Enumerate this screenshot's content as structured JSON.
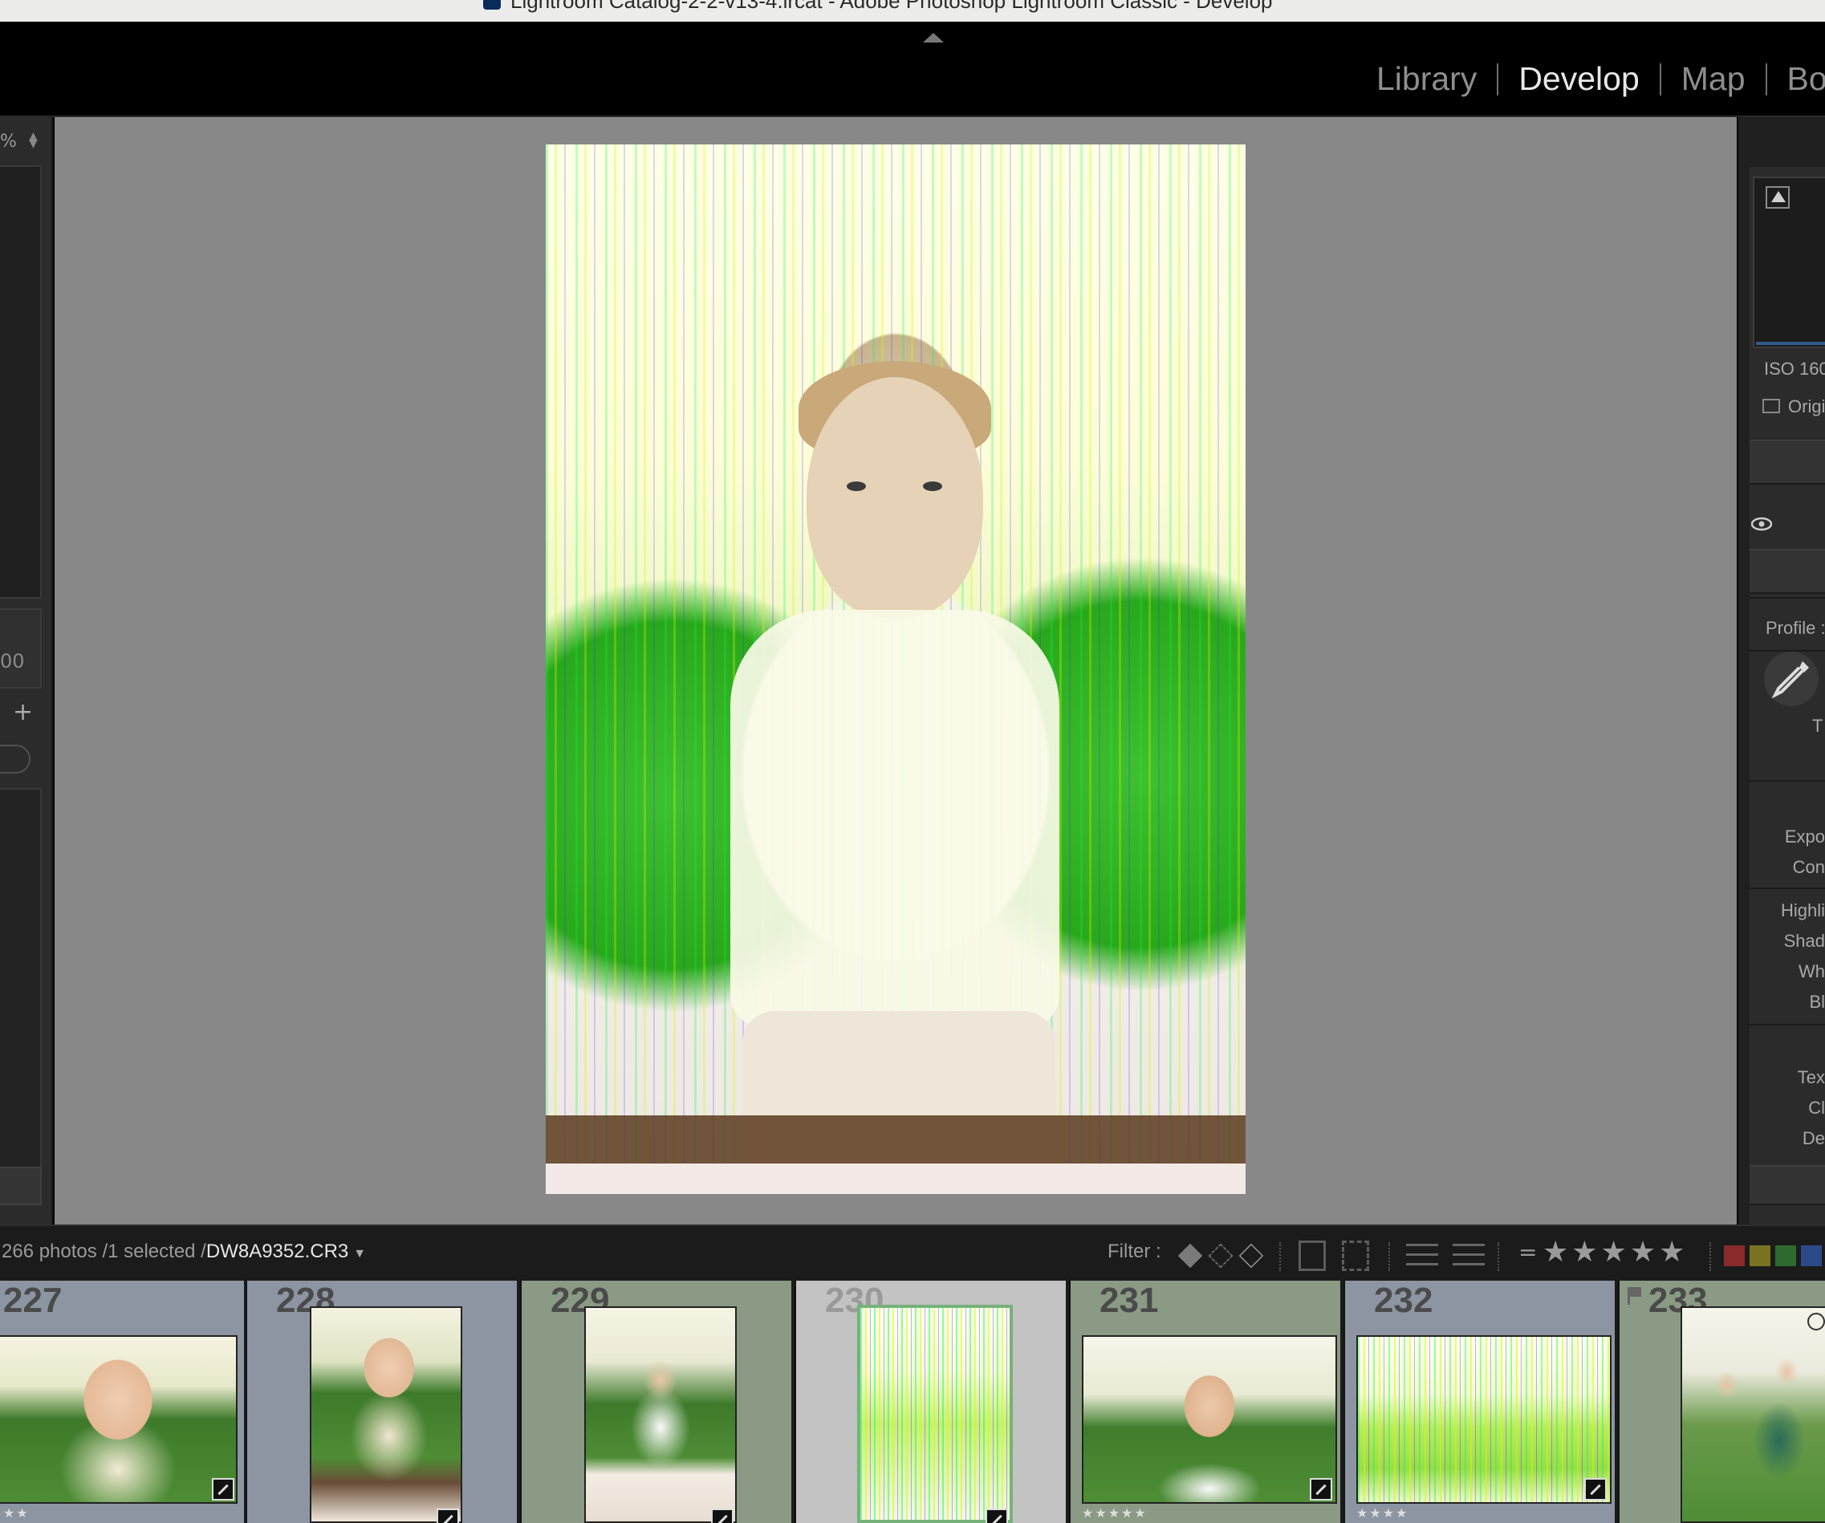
{
  "window": {
    "title": "Lightroom Catalog-2-2-v13-4.lrcat - Adobe Photoshop Lightroom Classic - Develop"
  },
  "modules": {
    "items": [
      {
        "label": "Library",
        "active": false
      },
      {
        "label": "Develop",
        "active": true
      },
      {
        "label": "Map",
        "active": false
      },
      {
        "label": "Boo",
        "active": false
      }
    ]
  },
  "left_panel": {
    "zoom_text": "%",
    "value_text": "00",
    "add_label": "+"
  },
  "right_panel": {
    "iso": "ISO 160",
    "original_label": "Origi",
    "profile_label": "Profile :",
    "wb_label": "T",
    "tone_labels": [
      "Expo",
      "Con"
    ],
    "presence_labels": [
      "Highli",
      "Shad",
      "Wh",
      "Bl"
    ],
    "texture_labels": [
      "Tex",
      "Cl",
      "De"
    ]
  },
  "filmstrip_bar": {
    "count_text": "266 photos /1 selected /",
    "filename": "DW8A9352.CR3",
    "filter_label": "Filter :",
    "equals": "=",
    "stars": "★★★★★",
    "color_labels": [
      "#8a2a2a",
      "#7a7420",
      "#2e6a2e",
      "#2a4a8a"
    ]
  },
  "filmstrip": {
    "cells": [
      {
        "number": "227",
        "rating": "★★",
        "bg": "#8d94a2"
      },
      {
        "number": "228",
        "rating": "",
        "bg": "#8d94a2"
      },
      {
        "number": "229",
        "rating": "",
        "bg": "#8a9a84"
      },
      {
        "number": "230",
        "rating": "",
        "bg": "#c3c3c3"
      },
      {
        "number": "231",
        "rating": "★★★★★",
        "bg": "#8a9a84"
      },
      {
        "number": "232",
        "rating": "★★★★",
        "bg": "#8d94a2"
      },
      {
        "number": "233",
        "rating": "",
        "bg": "#8a9a84"
      }
    ]
  }
}
